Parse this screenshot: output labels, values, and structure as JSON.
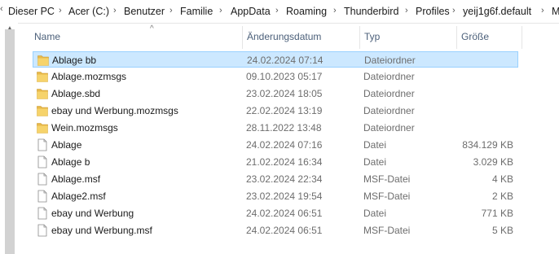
{
  "breadcrumb": {
    "items": [
      "Dieser PC",
      "Acer (C:)",
      "Benutzer",
      "Familie",
      "AppData",
      "Roaming",
      "Thunderbird",
      "Profiles",
      "yeij1g6f.default",
      "M"
    ],
    "separator": "›"
  },
  "columns": {
    "name": "Name",
    "date": "Änderungsdatum",
    "type": "Typ",
    "size": "Größe"
  },
  "files": [
    {
      "name": "Ablage bb",
      "date": "24.02.2024 07:14",
      "type": "Dateiordner",
      "size": "",
      "icon": "folder-icon",
      "selected": true
    },
    {
      "name": "Ablage.mozmsgs",
      "date": "09.10.2023 05:17",
      "type": "Dateiordner",
      "size": "",
      "icon": "folder-icon",
      "selected": false
    },
    {
      "name": "Ablage.sbd",
      "date": "23.02.2024 18:05",
      "type": "Dateiordner",
      "size": "",
      "icon": "folder-icon",
      "selected": false
    },
    {
      "name": "ebay und Werbung.mozmsgs",
      "date": "22.02.2024 13:19",
      "type": "Dateiordner",
      "size": "",
      "icon": "folder-icon",
      "selected": false
    },
    {
      "name": "Wein.mozmsgs",
      "date": "28.11.2022 13:48",
      "type": "Dateiordner",
      "size": "",
      "icon": "folder-icon",
      "selected": false
    },
    {
      "name": "Ablage",
      "date": "24.02.2024 07:16",
      "type": "Datei",
      "size": "834.129 KB",
      "icon": "file-icon",
      "selected": false
    },
    {
      "name": "Ablage b",
      "date": "21.02.2024 16:34",
      "type": "Datei",
      "size": "3.029 KB",
      "icon": "file-icon",
      "selected": false
    },
    {
      "name": "Ablage.msf",
      "date": "23.02.2024 22:34",
      "type": "MSF-Datei",
      "size": "4 KB",
      "icon": "file-icon",
      "selected": false
    },
    {
      "name": "Ablage2.msf",
      "date": "23.02.2024 19:54",
      "type": "MSF-Datei",
      "size": "2 KB",
      "icon": "file-icon",
      "selected": false
    },
    {
      "name": "ebay und Werbung",
      "date": "24.02.2024 06:51",
      "type": "Datei",
      "size": "771 KB",
      "icon": "file-icon",
      "selected": false
    },
    {
      "name": "ebay und Werbung.msf",
      "date": "24.02.2024 06:51",
      "type": "MSF-Datei",
      "size": "5 KB",
      "icon": "file-icon",
      "selected": false
    }
  ]
}
